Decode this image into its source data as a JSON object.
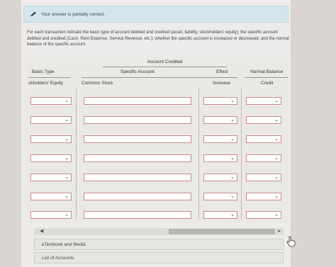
{
  "banner": {
    "text": "Your answer is partially correct."
  },
  "instructions": "For each transaction indicate the basic type of account debited and credited (asset, liability, stockholders' equity); the specific account debited and credited (Cash, Rent Expense, Service Revenue, etc.); whether the specific account is increased or decreased; and the normal balance of the specific account.",
  "table": {
    "group_header": "Account Credited",
    "col_basic_type": "Basic Type",
    "col_specific": "Specific Account",
    "col_effect": "Effect",
    "col_normal": "Normal Balance",
    "row1_basic": "ckholders' Equity",
    "row1_specific": "Common Stock",
    "row1_effect": "Increase",
    "row1_normal": "Credit"
  },
  "buttons": {
    "etextbook": "eTextbook and Media",
    "list_accounts": "List of Accounts"
  },
  "icons": {
    "banner": "pencil-icon",
    "chevron": "chevron-down-icon"
  }
}
